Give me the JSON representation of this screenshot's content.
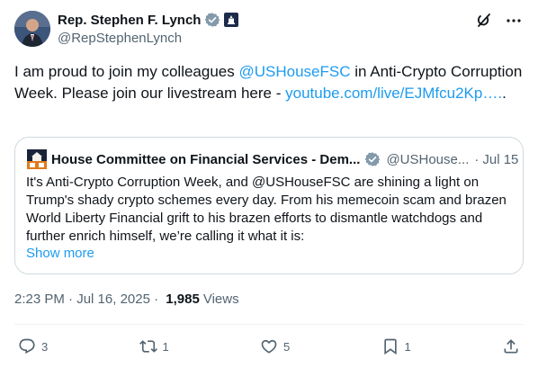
{
  "colors": {
    "accent": "#1d9bf0",
    "text": "#0f1419",
    "muted": "#536471",
    "border": "#cfd9de",
    "verified": "#829aab"
  },
  "author": {
    "name": "Rep. Stephen F. Lynch",
    "handle": "@RepStephenLynch",
    "verified_icon": "verified-grey-badge-icon",
    "affiliation_icon": "capitol-flag-icon"
  },
  "top_icons": [
    "grok-icon",
    "more-icon"
  ],
  "post": {
    "text_before": "I am proud to join my colleagues ",
    "mention": "@USHouseFSC",
    "text_after": " in Anti-Crypto Corruption Week. Please join our livestream here - ",
    "link": "youtube.com/live/EJMfcu2Kp….",
    "trailing": "."
  },
  "quote": {
    "name": "House Committee on Financial Services - Dem...",
    "handle": "@USHouse...",
    "separator": "·",
    "date": "Jul 15",
    "text": "It's Anti-Crypto Corruption Week, and @USHouseFSC are shining a light on Trump's shady crypto schemes every day. From his memecoin scam and brazen World Liberty Financial grift to his brazen efforts to dismantle watchdogs and further enrich himself, we’re calling it what it is:",
    "show_more": "Show more"
  },
  "meta": {
    "time": "2:23 PM",
    "sep1": " · ",
    "date": "Jul 16, 2025",
    "sep2": " · ",
    "views_count": "1,985",
    "views_label": "Views"
  },
  "actions": {
    "replies": "3",
    "reposts": "1",
    "likes": "5",
    "bookmarks": "1"
  }
}
